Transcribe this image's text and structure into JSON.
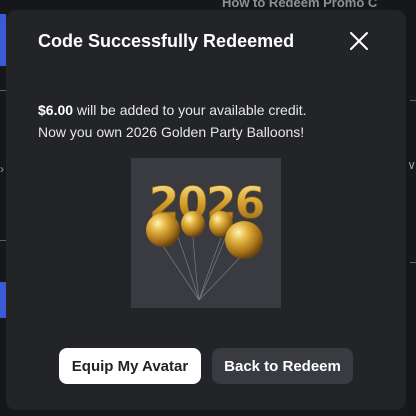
{
  "background": {
    "heading": "How to Redeem Promo C"
  },
  "modal": {
    "title": "Code Successfully Redeemed",
    "message": {
      "amount": "$6.00",
      "credit_text": " will be added to your available credit.",
      "own_text": "Now you own 2026 Golden Party Balloons!"
    },
    "item_image": {
      "number_text": "2026"
    },
    "buttons": {
      "equip_label": "Equip My Avatar",
      "back_label": "Back to Redeem"
    }
  },
  "colors": {
    "modal_bg": "#232428",
    "primary_button_bg": "#ffffff",
    "secondary_button_bg": "#393b41",
    "accent": "#3b5bd6",
    "balloon_gold": "#d9a531"
  },
  "icons": {
    "close": "close-icon"
  }
}
